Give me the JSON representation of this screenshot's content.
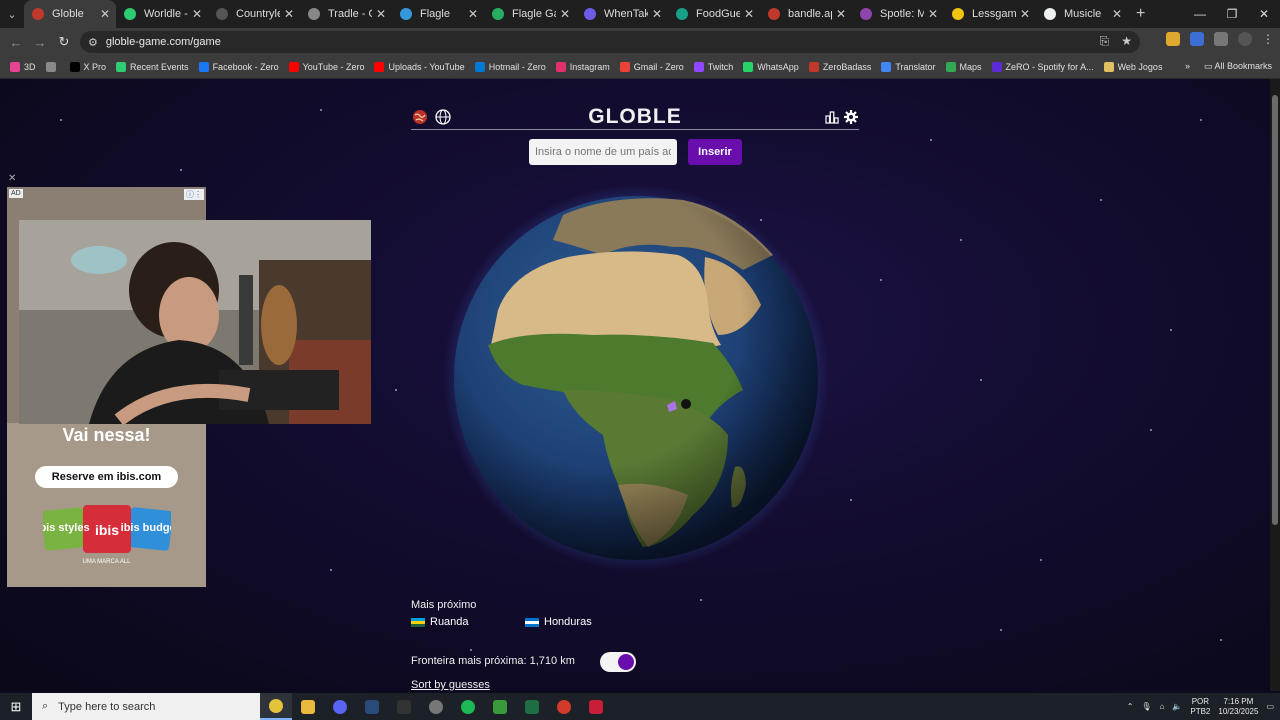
{
  "browser": {
    "tabs": [
      {
        "title": "Globle",
        "color": "#c0392b",
        "active": true
      },
      {
        "title": "Worldle - Gu",
        "color": "#2ecc71"
      },
      {
        "title": "Countryle - T",
        "color": "#555555"
      },
      {
        "title": "Tradle - Gue",
        "color": "#888888"
      },
      {
        "title": "Flagle",
        "color": "#3498db"
      },
      {
        "title": "Flagle Game",
        "color": "#27ae60"
      },
      {
        "title": "WhenTaken",
        "color": "#6c5ce7"
      },
      {
        "title": "FoodGuessr",
        "color": "#16a085"
      },
      {
        "title": "bandle.app/",
        "color": "#c0392b"
      },
      {
        "title": "Spotle: Musi",
        "color": "#8e44ad"
      },
      {
        "title": "Lessgames",
        "color": "#f1c40f"
      },
      {
        "title": "Musicle",
        "color": "#ecf0f1"
      }
    ],
    "new_tab": "+",
    "url": "globle-game.com/game",
    "bookmarks": [
      {
        "label": "3D",
        "color": "#e84393"
      },
      {
        "label": "",
        "color": "#888888"
      },
      {
        "label": "X Pro",
        "color": "#000000"
      },
      {
        "label": "Recent Events",
        "color": "#2ecc71"
      },
      {
        "label": "Facebook - Zero",
        "color": "#1877f2"
      },
      {
        "label": "YouTube - Zero",
        "color": "#ff0000"
      },
      {
        "label": "Uploads - YouTube",
        "color": "#ff0000"
      },
      {
        "label": "Hotmail - Zero",
        "color": "#0078d4"
      },
      {
        "label": "Instagram",
        "color": "#e1306c"
      },
      {
        "label": "Gmail - Zero",
        "color": "#ea4335"
      },
      {
        "label": "Twitch",
        "color": "#9146ff"
      },
      {
        "label": "WhatsApp",
        "color": "#25d366"
      },
      {
        "label": "ZeroBadass",
        "color": "#c0392b"
      },
      {
        "label": "Translator",
        "color": "#4285f4"
      },
      {
        "label": "Maps",
        "color": "#34a853"
      },
      {
        "label": "ZeRO - Spotify for A...",
        "color": "#5b2bd6"
      },
      {
        "label": "Web Jogos",
        "color": "#e0c060"
      }
    ],
    "bookmarks_more": "»",
    "all_bookmarks": "All Bookmarks"
  },
  "game": {
    "title": "GLOBLE",
    "search_placeholder": "Insira o nome de um país aqui",
    "insert_label": "Inserir",
    "closest_label": "Mais próximo",
    "guesses": [
      {
        "country": "Ruanda",
        "flag_colors": [
          "#00a1de",
          "#fad201",
          "#20603d"
        ]
      },
      {
        "country": "Honduras",
        "flag_colors": [
          "#0073cf",
          "#ffffff",
          "#0073cf"
        ]
      }
    ],
    "closest_border_label": "Fronteira mais próxima:",
    "closest_border_value": "1,710",
    "closest_border_unit": "km",
    "toggle_on": true,
    "sort_label": "Sort by guesses",
    "accent": "#6a0dad"
  },
  "ad": {
    "tag": "AD",
    "headline": "Vai nessa!",
    "cta": "Reserve em ibis.com",
    "logos": [
      "ibis styles",
      "ibis",
      "ibis budget"
    ],
    "brand": "UMA MARCA ALL"
  },
  "taskbar": {
    "search_placeholder": "Type here to search",
    "lang": "POR",
    "lang_sub": "PTB2",
    "time": "7:16 PM",
    "date": "10/23/2025"
  }
}
